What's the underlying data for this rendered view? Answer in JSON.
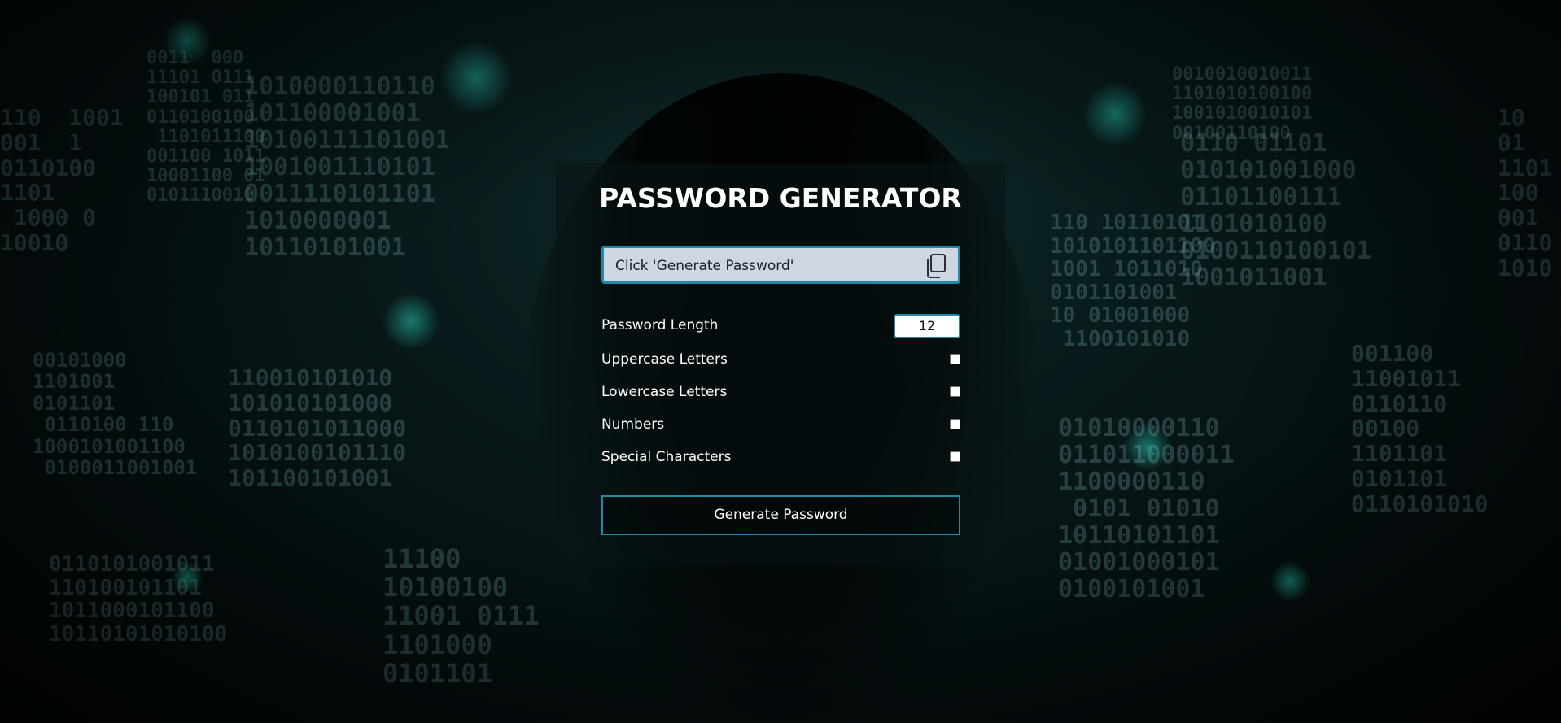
{
  "app": {
    "title": "PASSWORD GENERATOR"
  },
  "output": {
    "placeholder_text": "Click 'Generate Password'",
    "copy_icon": "copy-icon"
  },
  "options": {
    "length_label": "Password Length",
    "length_value": "12",
    "uppercase_label": "Uppercase Letters",
    "lowercase_label": "Lowercase Letters",
    "numbers_label": "Numbers",
    "special_label": "Special Characters",
    "uppercase_checked": false,
    "lowercase_checked": false,
    "numbers_checked": false,
    "special_checked": false
  },
  "actions": {
    "generate_label": "Generate Password"
  },
  "theme": {
    "accent": "#1f8aa5",
    "output_bg": "#cdd6e2",
    "background": "#050f10"
  }
}
